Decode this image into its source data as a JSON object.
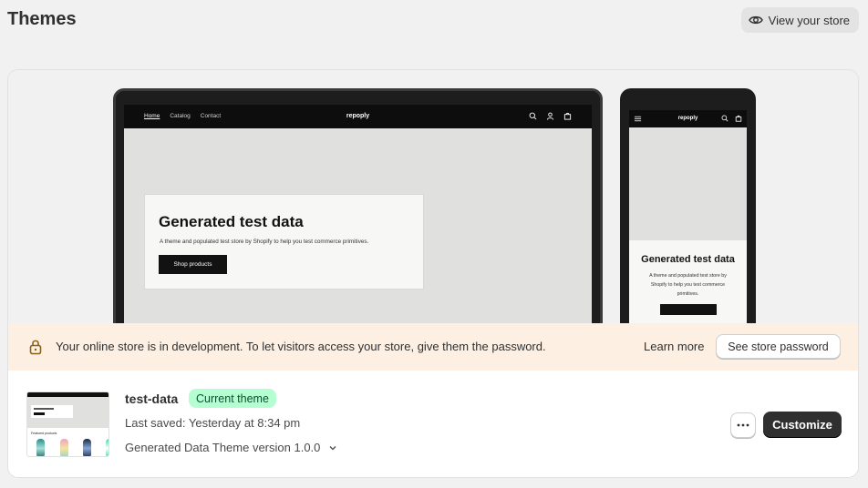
{
  "header": {
    "title": "Themes",
    "view_store_label": "View your store"
  },
  "preview": {
    "nav_links": [
      "Home",
      "Catalog",
      "Contact"
    ],
    "brand": "repoply",
    "hero_title": "Generated test data",
    "hero_description": "A theme and populated test store by Shopify to help you test commerce primitives.",
    "hero_button": "Shop products",
    "mobile_hero_title": "Generated test data",
    "mobile_hero_description": "A theme and populated test store by Shopify to help you test commerce primitives."
  },
  "banner": {
    "message": "Your online store is in development. To let visitors access your store, give them the password.",
    "learn_more": "Learn more",
    "see_password": "See store password"
  },
  "theme": {
    "name": "test-data",
    "badge": "Current theme",
    "last_saved": "Last saved: Yesterday at 8:34 pm",
    "version": "Generated Data Theme version 1.0.0",
    "customize_label": "Customize",
    "thumbnail": {
      "hero_label": "Generated test data",
      "section_label": "Featured products"
    }
  },
  "colors": {
    "background": "#f1f1f1",
    "banner_bg": "#fdf0e3",
    "badge_bg": "#b4fed2",
    "primary_button": "#303030"
  }
}
